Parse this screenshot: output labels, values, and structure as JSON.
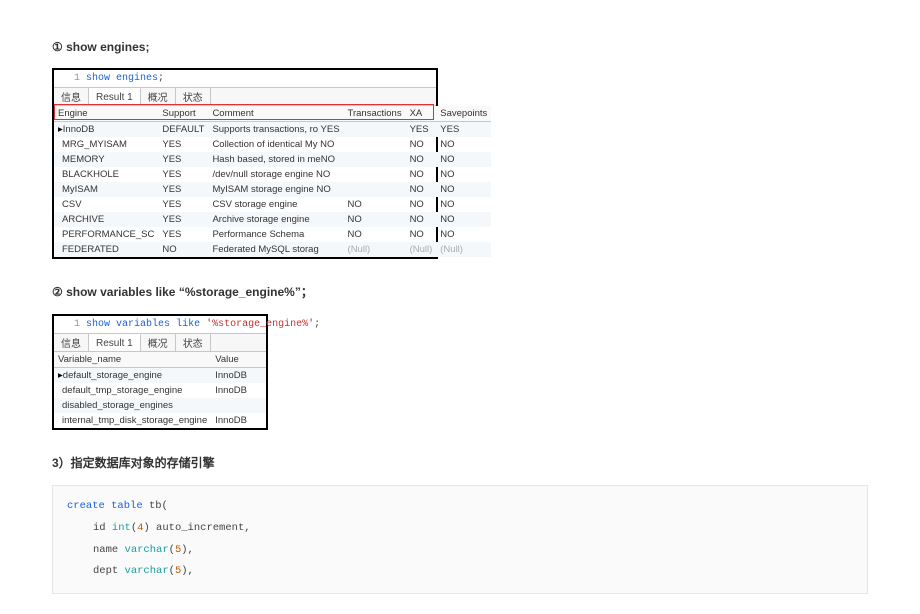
{
  "section1": {
    "heading": "①  show engines;",
    "code_ln": "1",
    "code_kw": "show",
    "code_kw2": "engines",
    "code_tail": ";"
  },
  "tabs": {
    "t1": "信息",
    "t2": "Result 1",
    "t3": "概况",
    "t4": "状态"
  },
  "table1": {
    "headers": [
      "Engine",
      "Support",
      "Comment",
      "Transactions",
      "XA",
      "Savepoints"
    ],
    "rows": [
      [
        "InnoDB",
        "DEFAULT",
        "Supports transactions, ro",
        "YES",
        "YES",
        "YES"
      ],
      [
        "MRG_MYISAM",
        "YES",
        "Collection of identical My",
        "NO",
        "NO",
        "NO"
      ],
      [
        "MEMORY",
        "YES",
        "Hash based, stored in me",
        "NO",
        "NO",
        "NO"
      ],
      [
        "BLACKHOLE",
        "YES",
        "/dev/null storage engine",
        "NO",
        "NO",
        "NO"
      ],
      [
        "MyISAM",
        "YES",
        "MyISAM storage engine",
        "NO",
        "NO",
        "NO"
      ],
      [
        "CSV",
        "YES",
        "CSV storage engine",
        "NO",
        "NO",
        "NO"
      ],
      [
        "ARCHIVE",
        "YES",
        "Archive storage engine",
        "NO",
        "NO",
        "NO"
      ],
      [
        "PERFORMANCE_SC",
        "YES",
        "Performance Schema",
        "NO",
        "NO",
        "NO"
      ],
      [
        "FEDERATED",
        "NO",
        "Federated MySQL storag",
        "(Null)",
        "(Null)",
        "(Null)"
      ]
    ]
  },
  "section2": {
    "heading": "②  show variables like “%storage_engine%”；",
    "code_ln": "1",
    "code_a": "show",
    "code_b": "variables",
    "code_c": "like",
    "code_str": "'%storage_engine%'",
    "code_tail": ";"
  },
  "table2": {
    "headers": [
      "Variable_name",
      "Value"
    ],
    "rows": [
      [
        "default_storage_engine",
        "InnoDB"
      ],
      [
        "default_tmp_storage_engine",
        "InnoDB"
      ],
      [
        "disabled_storage_engines",
        ""
      ],
      [
        "internal_tmp_disk_storage_engine",
        "InnoDB"
      ]
    ]
  },
  "section3": {
    "heading": "3）指定数据库对象的存储引擎",
    "code": {
      "l1a": "create",
      "l1b": "table",
      "l1c": " tb(",
      "l2a": "id ",
      "l2b": "int",
      "l2c": "(",
      "l2d": "4",
      "l2e": ") auto_increment,",
      "l3a": "name ",
      "l3b": "varchar",
      "l3c": "(",
      "l3d": "5",
      "l3e": "),",
      "l4a": "dept ",
      "l4b": "varchar",
      "l4c": "(",
      "l4d": "5",
      "l4e": "),"
    }
  }
}
